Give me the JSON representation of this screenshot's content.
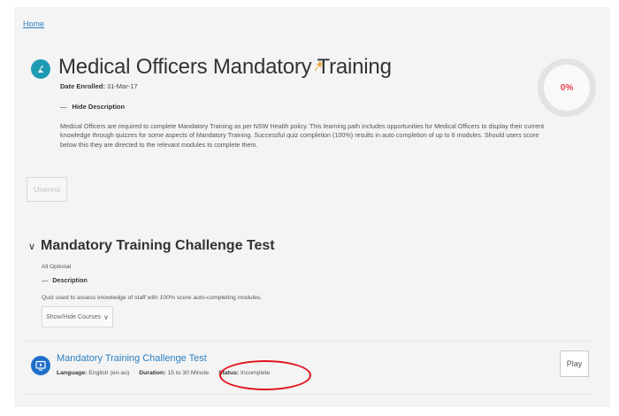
{
  "breadcrumb": {
    "home": "Home"
  },
  "learning_path": {
    "title": "Medical Officers Mandatory Training",
    "date_enrolled_label": "Date Enrolled:",
    "date_enrolled_value": "31-Mar-17",
    "hide_description_label": "Hide Description",
    "description": "Medical Officers are required to complete Mandatory Training as per NSW Health policy. This learning path includes opportunities for Medical Officers to display their current knowledge through quizzes for some aspects of Mandatory Training. Successful quiz completion (100%) results in auto completion of up to 6 modules. Should users score below this they are directed to the relevant modules to complete them.",
    "progress_percent": "0%",
    "progress_value": 0,
    "unenrol_label": "Unenrol"
  },
  "section": {
    "title": "Mandatory Training Challenge Test",
    "optional_text": "All Optional",
    "description_toggle": "Description",
    "description": "Quiz used to assess knowledge of staff with 100% score auto-completing modules.",
    "show_hide_label": "Show/Hide Courses",
    "course": {
      "title": "Mandatory Training Challenge Test",
      "language_label": "Language:",
      "language_value": "English (en-au)",
      "duration_label": "Duration:",
      "duration_value": "15 to 30 Minute",
      "status_label": "Status:",
      "status_value": "Incomplete",
      "play_label": "Play",
      "icon": "play-screen-icon"
    }
  },
  "colors": {
    "accent": "#2a7fc1",
    "logo_teal": "#1e9ab3",
    "progress_red": "#e8414a",
    "annotation_red": "#e0121c"
  }
}
